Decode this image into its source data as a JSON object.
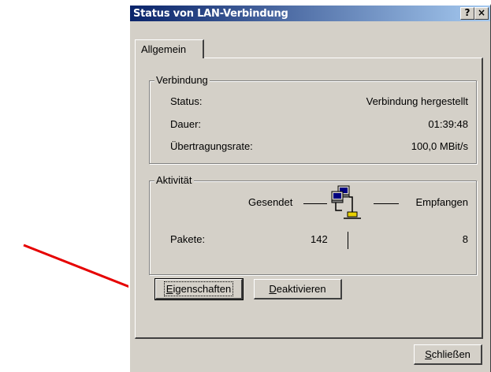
{
  "window": {
    "title": "Status von LAN-Verbindung",
    "help_label": "?",
    "close_label": "×"
  },
  "tabs": [
    {
      "label": "Allgemein"
    }
  ],
  "connection_group": {
    "title": "Verbindung",
    "rows": [
      {
        "label": "Status:",
        "value": "Verbindung hergestellt"
      },
      {
        "label": "Dauer:",
        "value": "01:39:48"
      },
      {
        "label": "Übertragungsrate:",
        "value": "100,0 MBit/s"
      }
    ]
  },
  "activity_group": {
    "title": "Aktivität",
    "sent_label": "Gesendet",
    "received_label": "Empfangen",
    "packets_label": "Pakete:",
    "packets_sent": "142",
    "packets_received": "8",
    "icon": "network-computers-icon"
  },
  "buttons": {
    "properties": {
      "accel": "E",
      "rest": "igenschaften"
    },
    "deactivate": {
      "accel": "D",
      "rest": "eaktivieren"
    },
    "close": {
      "accel": "S",
      "rest": "chließen"
    }
  },
  "annotation": {
    "arrow_color": "#e60000"
  },
  "colors": {
    "titlebar_start": "#0a246a",
    "titlebar_end": "#a6caf0",
    "face": "#d4d0c8"
  }
}
